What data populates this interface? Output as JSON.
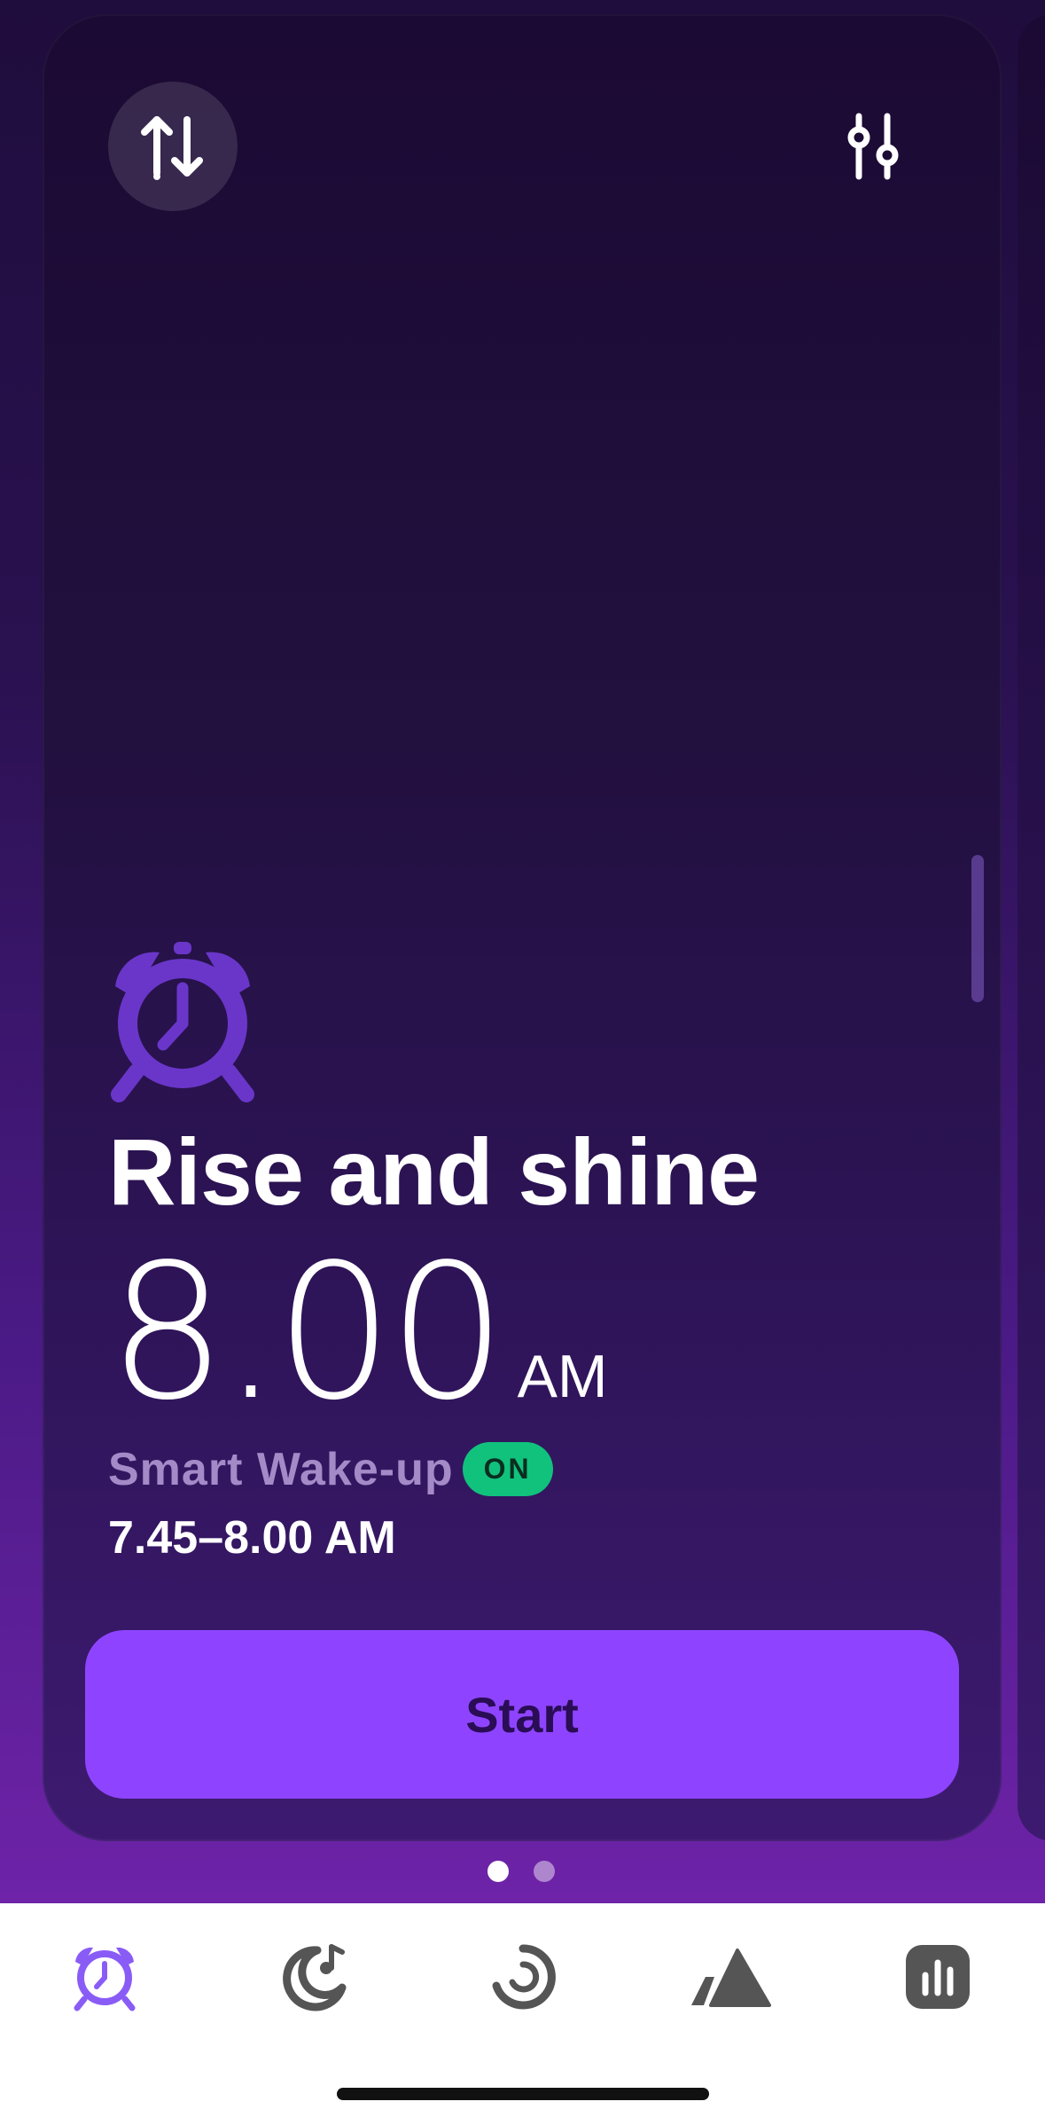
{
  "alarm": {
    "title": "Rise and shine",
    "time": "8.00",
    "ampm": "AM",
    "smart_wakeup_label": "Smart Wake-up",
    "smart_wakeup_status": "ON",
    "window": "7.45–8.00 AM",
    "start_label": "Start"
  },
  "pager": {
    "pages": 2,
    "active": 0
  },
  "toolbar": {
    "left_icon": "sort-up-down-icon",
    "right_icon": "sliders-icon"
  },
  "tabs": [
    {
      "icon": "alarm-clock-icon",
      "active": true
    },
    {
      "icon": "moon-music-icon",
      "active": false
    },
    {
      "icon": "progress-ring-icon",
      "active": false
    },
    {
      "icon": "mountain-icon",
      "active": false
    },
    {
      "icon": "bar-chart-icon",
      "active": false
    }
  ],
  "colors": {
    "accent": "#8e44ff",
    "on_badge": "#11c27d",
    "active_tab": "#8a5cf6",
    "inactive_tab": "#555555"
  }
}
